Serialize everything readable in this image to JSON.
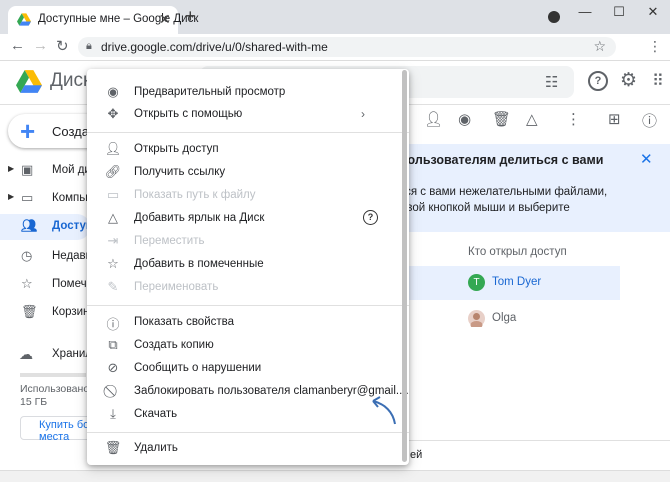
{
  "browser": {
    "tab_title": "Доступные мне – Google Диск",
    "tab_close": "✕",
    "new_tab": "+",
    "url": "drive.google.com/drive/u/0/shared-with-me",
    "win_min": "—",
    "win_max": "☐",
    "win_close": "✕"
  },
  "header": {
    "app_name": "Диск"
  },
  "sidebar": {
    "create_label": "Создат",
    "items": [
      {
        "label": "Мой дис",
        "icon": "drive-folder-icon"
      },
      {
        "label": "Компью",
        "icon": "computers-icon"
      },
      {
        "label": "Доступ",
        "icon": "shared-people-icon"
      },
      {
        "label": "Недавн",
        "icon": "clock-icon"
      },
      {
        "label": "Помече",
        "icon": "star-icon"
      },
      {
        "label": "Корзина",
        "icon": "trash-icon"
      }
    ],
    "storage_label": "Хранил",
    "storage_used": "Использовано 15 ГБ",
    "buy_label": "Купить бо места"
  },
  "banner": {
    "title": "пользователям делиться с вами",
    "text1": "тся с вами нежелательными файлами,",
    "text2": "авой кнопкой мыши и выберите"
  },
  "table": {
    "col_shared_by": "Кто открыл доступ",
    "rows": [
      {
        "avatar_letter": "T",
        "name": "Tom Dyer"
      },
      {
        "avatar_letter": "",
        "name": "Olga"
      }
    ]
  },
  "bottom_text": "ей",
  "context_menu": {
    "items": [
      {
        "label": "Предварительный просмотр",
        "icon": "eye-icon",
        "disabled": false
      },
      {
        "label": "Открыть с помощью",
        "icon": "move-arrows-icon",
        "disabled": false,
        "submenu": "›"
      },
      {
        "label": "Открыть доступ",
        "icon": "person-add-icon",
        "disabled": false
      },
      {
        "label": "Получить ссылку",
        "icon": "link-icon",
        "disabled": false
      },
      {
        "label": "Показать путь к файлу",
        "icon": "folder-icon",
        "disabled": true
      },
      {
        "label": "Добавить ярлык на Диск",
        "icon": "add-shortcut-icon",
        "disabled": false,
        "help": "?"
      },
      {
        "label": "Переместить",
        "icon": "move-to-icon",
        "disabled": true
      },
      {
        "label": "Добавить в помеченные",
        "icon": "star-icon",
        "disabled": false
      },
      {
        "label": "Переименовать",
        "icon": "pencil-icon",
        "disabled": true
      },
      {
        "label": "Показать свойства",
        "icon": "info-icon",
        "disabled": false
      },
      {
        "label": "Создать копию",
        "icon": "copy-icon",
        "disabled": false
      },
      {
        "label": "Сообщить о нарушении",
        "icon": "report-icon",
        "disabled": false
      },
      {
        "label": "Заблокировать пользователя clamanberyr@gmail....",
        "icon": "block-icon",
        "disabled": false
      },
      {
        "label": "Скачать",
        "icon": "download-icon",
        "disabled": false
      },
      {
        "label": "Удалить",
        "icon": "trash-icon",
        "disabled": false
      }
    ]
  },
  "colors": {
    "accent": "#1a73e8",
    "active_bg": "#e8f0fe",
    "avatar_tom": "#34a853"
  }
}
